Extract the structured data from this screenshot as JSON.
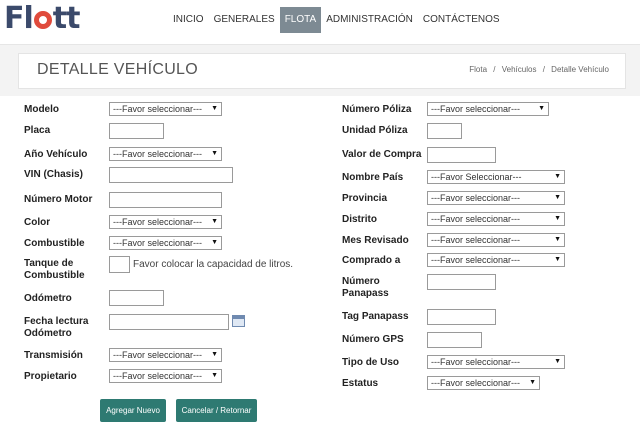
{
  "brand": {
    "logo_pre": "Fl",
    "logo_post": "tt"
  },
  "nav": {
    "items": [
      {
        "label": "INICIO"
      },
      {
        "label": "GENERALES"
      },
      {
        "label": "FLOTA"
      },
      {
        "label": "ADMINISTRACIÓN"
      },
      {
        "label": "CONTÁCTENOS"
      }
    ],
    "active": "FLOTA"
  },
  "page": {
    "title": "DETALLE VEHÍCULO",
    "breadcrumb": [
      "Flota",
      "Vehículos",
      "Detalle Vehículo"
    ],
    "separator": "/"
  },
  "form": {
    "left": {
      "modelo": {
        "label": "Modelo",
        "value": "---Favor seleccionar---"
      },
      "placa": {
        "label": "Placa",
        "value": ""
      },
      "anio": {
        "label": "Año Vehículo",
        "value": "---Favor seleccionar---"
      },
      "vin": {
        "label": "VIN (Chasis)",
        "value": ""
      },
      "motor": {
        "label": "Número Motor",
        "value": ""
      },
      "color": {
        "label": "Color",
        "value": "---Favor seleccionar---"
      },
      "combustible": {
        "label": "Combustible",
        "value": "---Favor seleccionar---"
      },
      "tanque": {
        "label_1": "Tanque de",
        "label_2": "Combustible",
        "value": "",
        "hint": "Favor colocar la capacidad de litros."
      },
      "odometro": {
        "label": "Odómetro",
        "value": ""
      },
      "fecha": {
        "label_1": "Fecha lectura",
        "label_2": "Odómetro",
        "value": ""
      },
      "transmision": {
        "label": "Transmisión",
        "value": "---Favor seleccionar---"
      },
      "propietario": {
        "label": "Propietario",
        "value": "---Favor seleccionar---"
      }
    },
    "right": {
      "poliza": {
        "label": "Número Póliza",
        "value": "---Favor seleccionar---"
      },
      "unidad_poliza": {
        "label": "Unidad Póliza",
        "value": ""
      },
      "valor_compra": {
        "label": "Valor de Compra",
        "value": ""
      },
      "pais": {
        "label": "Nombre País",
        "value": "---Favor Seleccionar---"
      },
      "provincia": {
        "label": "Provincia",
        "value": "---Favor seleccionar---"
      },
      "distrito": {
        "label": "Distrito",
        "value": "---Favor seleccionar---"
      },
      "mes_revisado": {
        "label": "Mes Revisado",
        "value": "---Favor seleccionar---"
      },
      "comprado": {
        "label": "Comprado a",
        "value": "---Favor seleccionar---"
      },
      "panapass": {
        "label_1": "Número",
        "label_2": "Panapass",
        "value": ""
      },
      "tag_panapass": {
        "label": "Tag Panapass",
        "value": ""
      },
      "gps": {
        "label": "Número GPS",
        "value": ""
      },
      "tipo_uso": {
        "label": "Tipo de Uso",
        "value": "---Favor seleccionar---"
      },
      "estatus": {
        "label": "Estatus",
        "value": "---Favor seleccionar---"
      }
    },
    "buttons": {
      "add": "Agregar Nuevo",
      "cancel": "Cancelar / Retornar"
    }
  },
  "colors": {
    "accent_button": "#2e7a72",
    "nav_active": "#7d8a93",
    "logo_text": "#3b4a6b",
    "logo_ring": "#e04b3c"
  }
}
